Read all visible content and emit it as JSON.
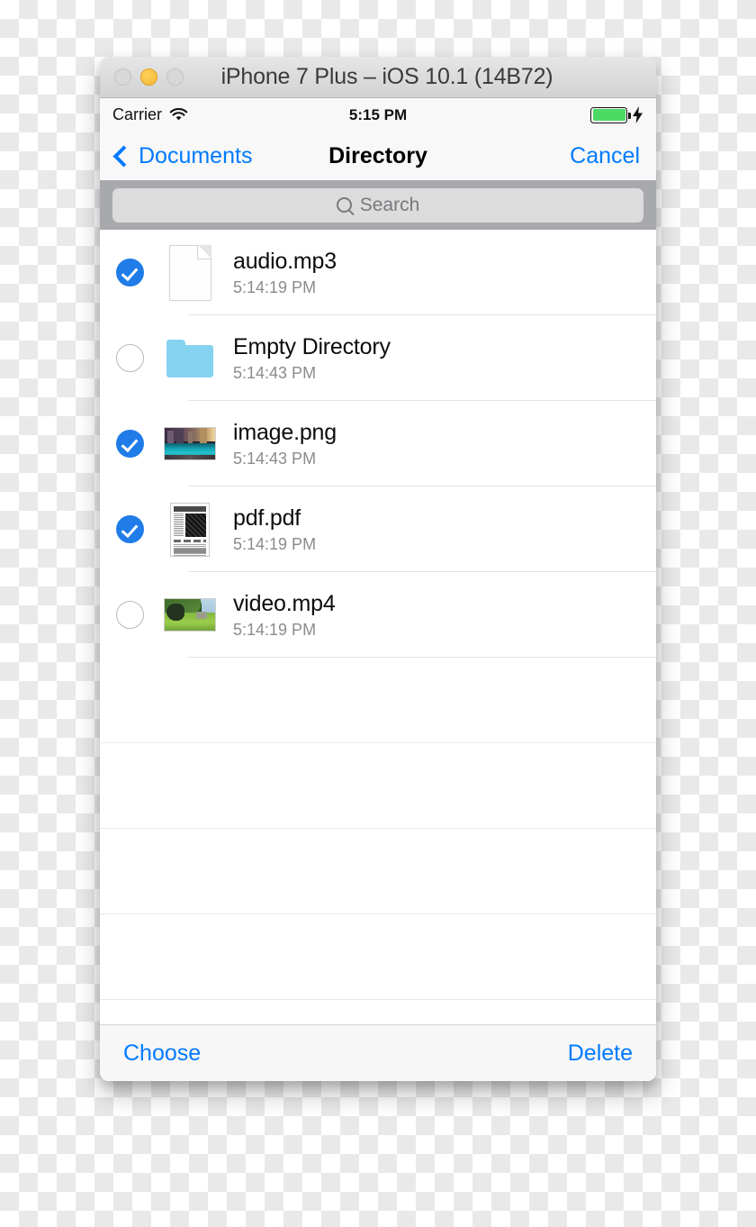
{
  "window": {
    "title": "iPhone 7 Plus – iOS 10.1 (14B72)",
    "traffic_lights": [
      {
        "name": "close-button",
        "color": "#d8d8d8"
      },
      {
        "name": "minimize-button",
        "color": "#f7b733"
      },
      {
        "name": "zoom-button",
        "color": "#d8d8d8"
      }
    ]
  },
  "status_bar": {
    "carrier": "Carrier",
    "wifi_icon": "wifi-icon",
    "time": "5:15 PM",
    "battery_icon": "battery-full-icon",
    "battery_level_percent": 100,
    "battery_color": "#4cd964",
    "charging_icon": "lightning-bolt-icon"
  },
  "nav_bar": {
    "back_icon": "chevron-left-icon",
    "back_label": "Documents",
    "title": "Directory",
    "cancel_label": "Cancel",
    "accent_color": "#007aff"
  },
  "search": {
    "icon": "search-icon",
    "placeholder": "Search",
    "value": ""
  },
  "file_list": {
    "items": [
      {
        "name": "audio.mp3",
        "date": "5:14:19 PM",
        "selected": true,
        "icon": "document-icon",
        "icon_type": "doc"
      },
      {
        "name": "Empty Directory",
        "date": "5:14:43 PM",
        "selected": false,
        "icon": "folder-icon",
        "icon_type": "folder"
      },
      {
        "name": "image.png",
        "date": "5:14:43 PM",
        "selected": true,
        "icon": "image-thumbnail",
        "icon_type": "image"
      },
      {
        "name": "pdf.pdf",
        "date": "5:14:19 PM",
        "selected": true,
        "icon": "pdf-thumbnail",
        "icon_type": "pdf"
      },
      {
        "name": "video.mp4",
        "date": "5:14:19 PM",
        "selected": false,
        "icon": "video-thumbnail",
        "icon_type": "video"
      }
    ],
    "empty_row_count": 4,
    "checked_color": "#1f7ce8"
  },
  "toolbar": {
    "choose_label": "Choose",
    "delete_label": "Delete",
    "accent_color": "#007aff"
  }
}
